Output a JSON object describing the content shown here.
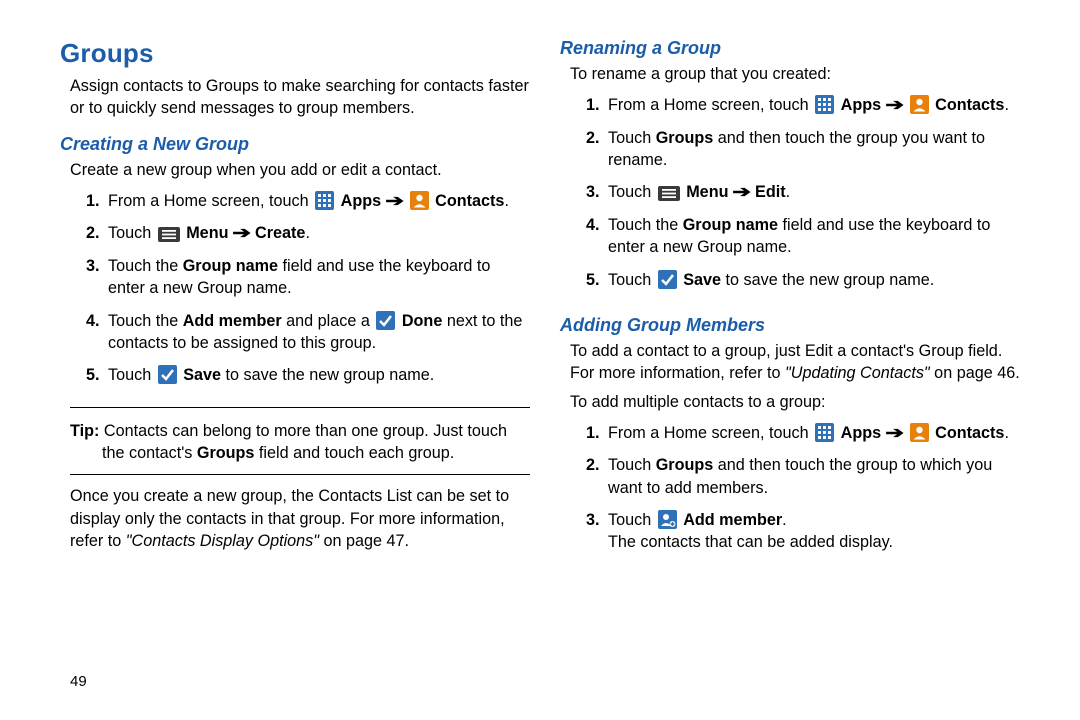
{
  "page_number": "49",
  "left": {
    "h1": "Groups",
    "intro": "Assign contacts to Groups to make searching for contacts faster or to quickly send messages to group members.",
    "h2a": "Creating a New Group",
    "sub_a": "Create a new group when you add or edit a contact.",
    "steps_a": {
      "s1a": "From a Home screen, touch ",
      "apps": "Apps",
      "contacts": "Contacts",
      "s2a": "Touch ",
      "menu": "Menu",
      "create": "Create",
      "s3a": "Touch the ",
      "groupname": "Group name",
      "s3b": " field and use the keyboard to enter a new Group name.",
      "s4a": "Touch the ",
      "addmember": "Add member",
      "s4b": " and place a ",
      "done": "Done",
      "s4c": " next to the contacts to be assigned to this group.",
      "s5a": "Touch ",
      "save": "Save",
      "s5b": " to save the new group name."
    },
    "tip_label": "Tip:",
    "tip_body_a": " Contacts can belong to more than one group. Just touch",
    "tip_body_b": "the contact's ",
    "tip_groups": "Groups",
    "tip_body_c": " field and touch each group.",
    "after_a": "Once you create a new group, the Contacts List can be set to display only the contacts in that group. For more information, refer to ",
    "after_ref": "\"Contacts Display Options\"",
    "after_b": " on page 47."
  },
  "right": {
    "h2b": "Renaming a Group",
    "sub_b": "To rename a group that you created:",
    "steps_b": {
      "s1a": "From a Home screen, touch ",
      "apps": "Apps",
      "contacts": "Contacts",
      "s2a": "Touch ",
      "groups": "Groups",
      "s2b": " and then touch the group you want to rename.",
      "s3a": "Touch ",
      "menu": "Menu",
      "edit": "Edit",
      "s4a": "Touch the ",
      "groupname": "Group name",
      "s4b": " field and use the keyboard to enter a new Group name.",
      "s5a": "Touch ",
      "save": "Save",
      "s5b": " to save the new group name."
    },
    "h2c": "Adding Group Members",
    "sub_c1a": "To add a contact to a group, just Edit a contact's Group field. For more information, refer to ",
    "sub_c1_ref": "\"Updating Contacts\"",
    "sub_c1b": " on page 46.",
    "sub_c2": "To add multiple contacts to a group:",
    "steps_c": {
      "s1a": "From a Home screen, touch ",
      "apps": "Apps",
      "contacts": "Contacts",
      "s2a": "Touch ",
      "groups": "Groups",
      "s2b": " and then touch the group to which you want to add members.",
      "s3a": "Touch ",
      "addmember": "Add member",
      "s3b": "The contacts that can be added display."
    }
  },
  "icons": {
    "apps": "apps-icon",
    "contacts": "contacts-icon",
    "menu": "menu-icon",
    "check": "check-icon",
    "addperson": "add-person-icon"
  },
  "period": "."
}
